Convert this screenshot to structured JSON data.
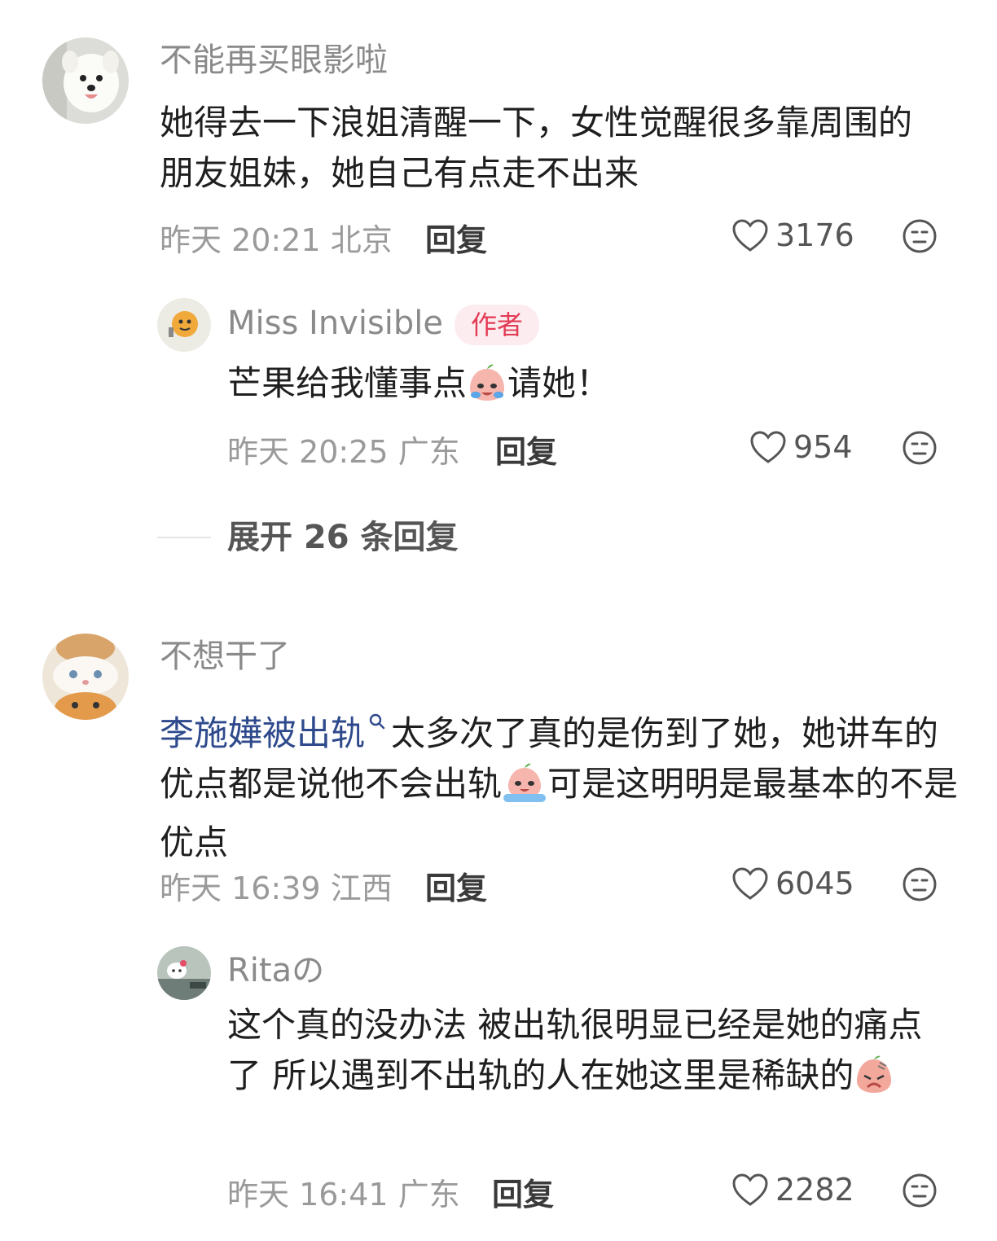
{
  "comments": [
    {
      "username": "不能再买眼影啦",
      "text": "她得去一下浪姐清醒一下，女性觉醒很多靠周围的朋友姐妹，她自己有点走不出来",
      "time": "昨天 20:21",
      "location": "北京",
      "reply_label": "回复",
      "likes": "3176",
      "avatar_icon": "samoyed-dog-avatar",
      "replies": [
        {
          "username": "Miss Invisible",
          "badge": "作者",
          "text_before_emoji": "芒果给我懂事点",
          "emoji": "crying-peach-emoji",
          "text_after_emoji": "请她！",
          "time": "昨天 20:25",
          "location": "广东",
          "reply_label": "回复",
          "likes": "954",
          "avatar_icon": "yellow-chick-avatar"
        }
      ],
      "expand_label": "展开 26 条回复"
    },
    {
      "username": "不想干了",
      "link_text": "李施嬅被出轨",
      "link_icon": "search-icon",
      "text_part1": "太多次了真的是伤到了她，她讲车的优点都是说他不会出轨",
      "emoji": "crying-peach-emoji",
      "text_part2": "可是这明明是最基本的不是优点",
      "time": "昨天 16:39",
      "location": "江西",
      "reply_label": "回复",
      "likes": "6045",
      "avatar_icon": "cats-stack-avatar",
      "replies": [
        {
          "username": "Ritaの",
          "text_before_emoji": "这个真的没办法 被出轨很明显已经是她的痛点了 所以遇到不出轨的人在她这里是稀缺的",
          "emoji": "sad-peach-emoji",
          "time": "昨天 16:41",
          "location": "广东",
          "reply_label": "回复",
          "likes": "2282",
          "avatar_icon": "hello-kitty-avatar"
        }
      ]
    }
  ],
  "colors": {
    "username": "#8a8a8a",
    "body": "#1f1f1f",
    "link": "#2e4a8c",
    "badge_bg": "#fdecef",
    "badge_text": "#e23b55"
  }
}
